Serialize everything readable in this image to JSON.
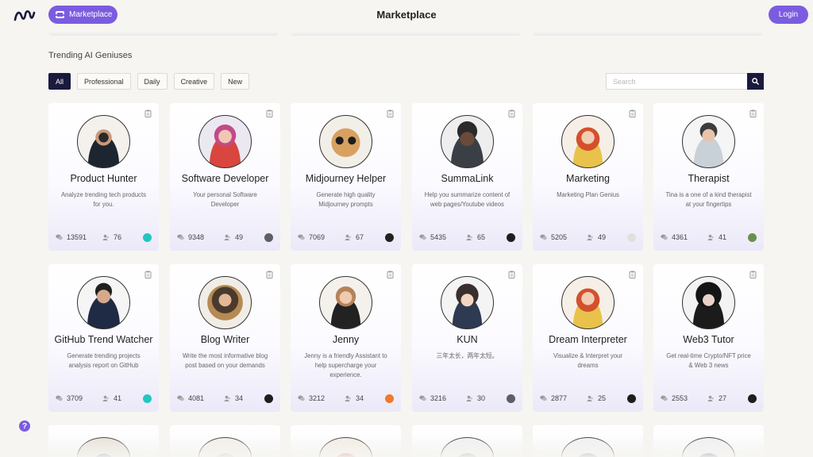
{
  "header": {
    "marketplace_button": "Marketplace",
    "title": "Marketplace",
    "login_button": "Login"
  },
  "section_title": "Trending AI Geniuses",
  "filters": [
    "All",
    "Professional",
    "Daily",
    "Creative",
    "New"
  ],
  "active_filter": "All",
  "search": {
    "placeholder": "Search",
    "value": ""
  },
  "accent_color": "#7b5ce0",
  "dark_color": "#1a1a3d",
  "cards": [
    {
      "name": "Product Hunter",
      "description": "Analyze trending tech products for you.",
      "chats": "13591",
      "users": "76",
      "creator_icon": "teal-logo"
    },
    {
      "name": "Software Developer",
      "description": "Your personal Software Developer",
      "chats": "9348",
      "users": "49",
      "creator_icon": "photo-avatar"
    },
    {
      "name": "Midjourney Helper",
      "description": "Generate high quality Midjourney prompts",
      "chats": "7069",
      "users": "67",
      "creator_icon": "dark-avatar"
    },
    {
      "name": "SummaLink",
      "description": "Help you summarize content of web pages/Youtube videos",
      "chats": "5435",
      "users": "65",
      "creator_icon": "dark-logo"
    },
    {
      "name": "Marketing",
      "description": "Marketing Plan Genius",
      "chats": "5205",
      "users": "49",
      "creator_icon": "default-avatar"
    },
    {
      "name": "Therapist",
      "description": "Tina is a one of a kind therapist at your fingertips",
      "chats": "4361",
      "users": "41",
      "creator_icon": "green-avatar"
    },
    {
      "name": "GitHub Trend Watcher",
      "description": "Generate trending projects analysis report on GitHub",
      "chats": "3709",
      "users": "41",
      "creator_icon": "teal-logo"
    },
    {
      "name": "Blog Writer",
      "description": "Write the most informative blog post based on your demands",
      "chats": "4081",
      "users": "34",
      "creator_icon": "dark-logo"
    },
    {
      "name": "Jenny",
      "description": "Jenny is a friendly Assistant to help supercharge your experience.",
      "chats": "3212",
      "users": "34",
      "creator_icon": "orange-avatar"
    },
    {
      "name": "KUN",
      "description": "三年太长，两年太短。",
      "chats": "3216",
      "users": "30",
      "creator_icon": "photo-avatar"
    },
    {
      "name": "Dream Interpreter",
      "description": "Visualize & Interpret your dreams",
      "chats": "2877",
      "users": "25",
      "creator_icon": "dark-logo"
    },
    {
      "name": "Web3 Tutor",
      "description": "Get real-time Crypto/NFT price & Web 3 news",
      "chats": "2553",
      "users": "27",
      "creator_icon": "dark-logo"
    }
  ],
  "icons": {
    "logo": "brand-wave-logo",
    "copy": "clipboard-icon",
    "chats": "chat-bubbles-icon",
    "users": "users-icon",
    "search": "search-icon",
    "help": "question-icon"
  },
  "help_label": "?"
}
